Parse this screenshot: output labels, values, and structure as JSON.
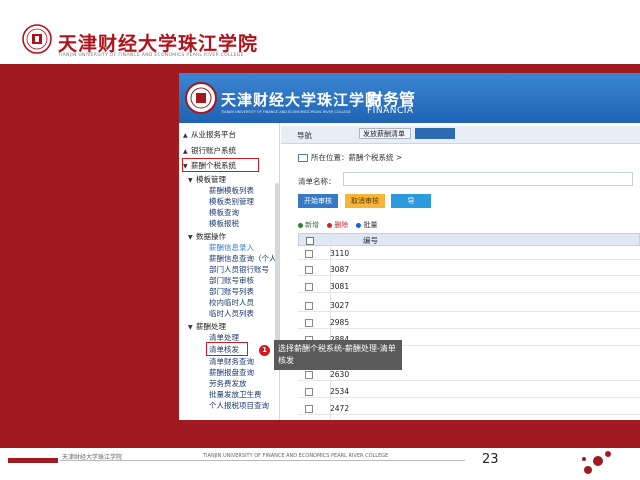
{
  "slide": {
    "university_cn": "天津财经大学珠江学院",
    "university_en": "TIANJIN UNIVERSITY OF FINANCE AND ECONOMICS PEARL RIVER COLLEGE",
    "footer_cn": "天津财经大学珠江学院",
    "footer_en": "TIANJIN UNIVERSITY OF FINANCE AND ECONOMICS PEARL RIVER COLLEGE",
    "page_number": "23"
  },
  "app": {
    "banner_title": "天津财经大学珠江学院",
    "banner_en": "TIANJIN UNIVERSITY OF FINANCE AND ECONOMICS PEARL RIVER COLLEGE",
    "system_title": "财务管",
    "system_title_en": "FINANCIA"
  },
  "tree": {
    "items": [
      {
        "label": "从业报务平台",
        "arrow": "▲"
      },
      {
        "label": "银行账户系统",
        "arrow": "▲"
      },
      {
        "label": "薪酬个税系统",
        "arrow": "▼"
      },
      {
        "label": "模板管理",
        "arrow": "▼"
      },
      {
        "label": "薪酬模板列表"
      },
      {
        "label": "模板类别管理"
      },
      {
        "label": "模板查询"
      },
      {
        "label": "模板报税"
      },
      {
        "label": "数据操作",
        "arrow": "▼"
      },
      {
        "label": "薪酬信息录入"
      },
      {
        "label": "薪酬信息查询（个人）"
      },
      {
        "label": "部门人员银行账号"
      },
      {
        "label": "部门账号审核"
      },
      {
        "label": "部门账号列表"
      },
      {
        "label": "校内临时人员"
      },
      {
        "label": "临时人员列表"
      },
      {
        "label": "薪酬处理",
        "arrow": "▼"
      },
      {
        "label": "清单处理"
      },
      {
        "label": "清单核发"
      },
      {
        "label": "清单财务查询"
      },
      {
        "label": "薪酬报盘查询"
      },
      {
        "label": "劳务费发放"
      },
      {
        "label": "批量发放卫生费"
      },
      {
        "label": "个人报税项目查询"
      }
    ]
  },
  "main": {
    "topbar_label": "导航",
    "topbar_select": "发放薪酬清单",
    "location": "所在位置：薪酬个税系统 >",
    "form_label": "清单名称：",
    "btn_start": "开始审核",
    "btn_cancel": "取消审核",
    "btn_other": "导",
    "toolbar_add": "新增",
    "toolbar_del": "删除",
    "toolbar_batch": "批量",
    "col_code": "编号",
    "rows": [
      "3110",
      "3087",
      "3081",
      "3027",
      "2985",
      "2884",
      "2630",
      "2534",
      "2472"
    ]
  },
  "tooltip": {
    "step": "1",
    "text": "选择薪酬个税系统-薪酬处理-清单核发"
  },
  "colors": {
    "slide_red": "#a01a1f",
    "banner_blue": "#2d6cb5",
    "highlight_red": "#d6191f"
  }
}
